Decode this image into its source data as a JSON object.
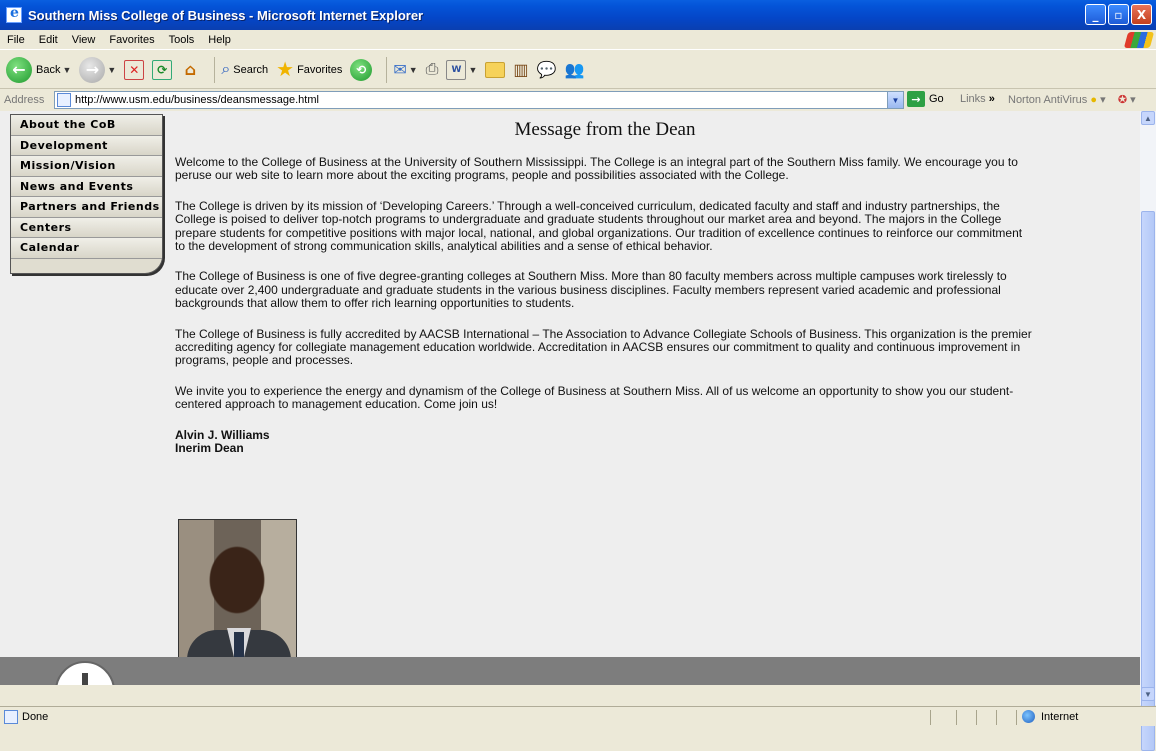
{
  "window": {
    "title": "Southern Miss College of Business - Microsoft Internet Explorer",
    "buttons": {
      "minimize": "_",
      "maximize": "▫",
      "close": "X"
    }
  },
  "menubar": [
    "File",
    "Edit",
    "View",
    "Favorites",
    "Tools",
    "Help"
  ],
  "toolbar": {
    "back_label": "Back",
    "search_label": "Search",
    "favorites_label": "Favorites"
  },
  "address": {
    "label": "Address",
    "url": "http://www.usm.edu/business/deansmessage.html",
    "go_label": "Go",
    "links_label": "Links",
    "norton_label": "Norton AntiVirus"
  },
  "nav": {
    "items": [
      "About the CoB",
      "Development",
      "Mission/Vision",
      "News and Events",
      "Partners and Friends",
      "Centers",
      "Calendar"
    ]
  },
  "content": {
    "heading": "Message from the Dean",
    "paragraphs": [
      "Welcome to the College of Business at the University of Southern Mississippi. The College is an integral part of the Southern Miss family. We encourage you to peruse our web site to learn more about the exciting programs, people and possibilities associated with the College.",
      "The College is driven by its mission of ‘Developing Careers.’ Through a well-conceived curriculum, dedicated faculty and staff and industry partnerships, the College is poised to deliver top-notch programs to undergraduate and graduate students throughout our market area and beyond. The majors in the College prepare students for competitive positions with major local, national, and global organizations. Our tradition of excellence continues to reinforce our commitment to the development of strong communication skills, analytical abilities and a sense of ethical behavior.",
      "The College of Business is one of five degree-granting colleges at Southern Miss. More than 80 faculty members across multiple campuses work tirelessly to educate over 2,400 undergraduate and graduate students in the various business disciplines. Faculty members represent varied academic and professional backgrounds that allow them to offer rich learning opportunities to students.",
      "The College of Business is fully accredited by AACSB International – The Association to Advance Collegiate Schools of Business. This organization is the premier accrediting agency for collegiate management education worldwide. Accreditation in AACSB ensures our commitment to quality and continuous improvement in programs, people and processes.",
      "We invite you to experience the energy and dynamism of the College of Business at Southern Miss. All of us welcome an opportunity to show you our student-centered approach to management education. Come join us!"
    ],
    "signature_name": "Alvin J. Williams",
    "signature_title": "Inerim Dean"
  },
  "status": {
    "text": "Done",
    "zone": "Internet"
  },
  "colors": {
    "titlebar": "#0A5FE0",
    "page_bg": "#EEEEEE",
    "chrome_bg": "#ECE9D8",
    "footer": "#7D7D7D"
  }
}
